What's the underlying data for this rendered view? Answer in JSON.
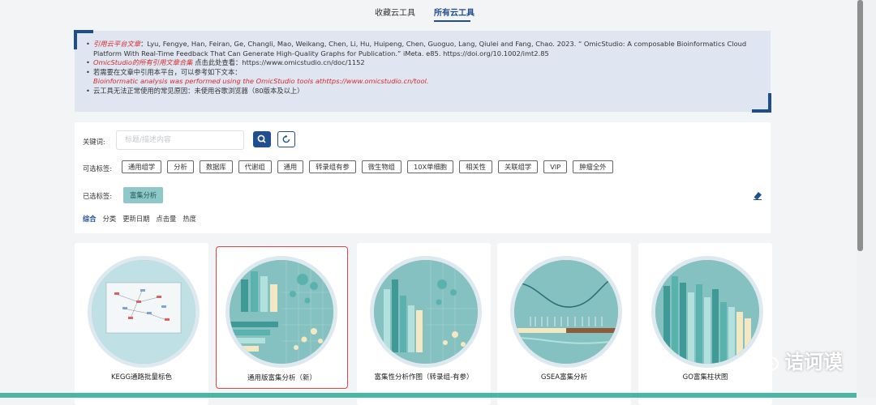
{
  "tabs": {
    "favorites": "收藏云工具",
    "all_tools": "所有云工具"
  },
  "notice": {
    "cite_label": "引用云平台文章",
    "cite_text": "：Lyu, Fengye, Han, Feiran, Ge, Changli, Mao, Weikang, Chen, Li, Hu, Huipeng, Chen, Guoguo, Lang, Qiulei and Fang, Chao. 2023. “ OmicStudio: A composable Bioinformatics Cloud Platform With Real-Time Feedback That Can Generate High-Quality Graphs for Publication.” iMeta. e85. https://doi.org/10.1002/imt2.85",
    "collection_label": "OmicStudio的所有引用文章合集",
    "collection_text": " 点击此处查看：https://www.omicstudio.cn/doc/1152",
    "cite_platform": "若需要在文章中引用本平台，可以参考如下文本：",
    "cite_sentence": "Bioinformatic analysis was performed using the OmicStudio tools athttps://www.omicstudio.cn/tool.",
    "browser_note": "云工具无法正常使用的常见原因：未使用谷歌浏览器（80版本及以上）"
  },
  "filter": {
    "keyword_label": "关键词:",
    "search_placeholder": "标题/描述内容",
    "search_value": "",
    "optional_label": "可选标签:",
    "tags": [
      "通用组学",
      "分析",
      "数据库",
      "代谢组",
      "通用",
      "转录组有参",
      "微生物组",
      "10X单细胞",
      "相关性",
      "关联组学",
      "VIP",
      "肿瘤全外"
    ],
    "selected_label": "已选标签:",
    "selected_tags": [
      "富集分析"
    ],
    "sort_options": [
      "综合",
      "分类",
      "更新日期",
      "点击量",
      "热度"
    ],
    "active_sort": "综合"
  },
  "cards": [
    {
      "title": "KEGG通路批量标色",
      "selected": false
    },
    {
      "title": "通用版富集分析（新）",
      "selected": true
    },
    {
      "title": "富集性分析作图（转录组-有参）",
      "selected": false
    },
    {
      "title": "GSEA富集分析",
      "selected": false
    },
    {
      "title": "GO富集柱状图",
      "selected": false
    }
  ],
  "watermark": "诘诃谟",
  "colors": {
    "accent": "#1f4f8f",
    "highlight": "#d62a2a",
    "teal": "#85c1c0",
    "selected_border": "#e24444"
  }
}
